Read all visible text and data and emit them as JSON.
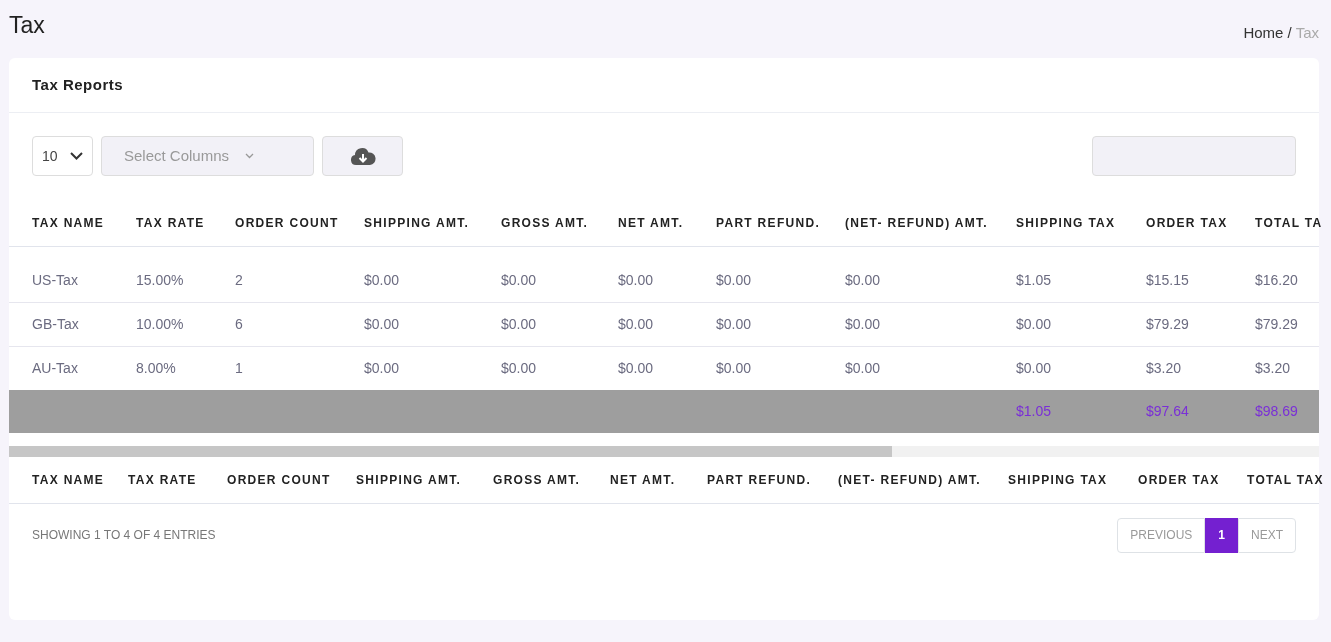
{
  "page_title": "Tax",
  "breadcrumb_separator": "/",
  "breadcrumb": [
    {
      "label": "Home",
      "active": false
    },
    {
      "label": "Tax",
      "active": true
    }
  ],
  "card_title": "Tax Reports",
  "toolbar": {
    "page_size": "10",
    "columns_select": "Select Columns"
  },
  "table": {
    "columns": [
      "TAX NAME",
      "TAX RATE",
      "ORDER COUNT",
      "SHIPPING AMT.",
      "GROSS AMT.",
      "NET AMT.",
      "PART REFUND.",
      "(NET- REFUND) AMT.",
      "SHIPPING TAX",
      "ORDER TAX",
      "TOTAL TA"
    ],
    "rows": [
      [
        "US-Tax",
        "15.00%",
        "2",
        "$0.00",
        "$0.00",
        "$0.00",
        "$0.00",
        "$0.00",
        "$1.05",
        "$15.15",
        "$16.20"
      ],
      [
        "GB-Tax",
        "10.00%",
        "6",
        "$0.00",
        "$0.00",
        "$0.00",
        "$0.00",
        "$0.00",
        "$0.00",
        "$79.29",
        "$79.29"
      ],
      [
        "AU-Tax",
        "8.00%",
        "1",
        "$0.00",
        "$0.00",
        "$0.00",
        "$0.00",
        "$0.00",
        "$0.00",
        "$3.20",
        "$3.20"
      ]
    ],
    "totals": {
      "shipping_tax": "$1.05",
      "order_tax": "$97.64",
      "total_tax": "$98.69"
    },
    "footer_columns": [
      "TAX NAME",
      "TAX RATE",
      "ORDER COUNT",
      "SHIPPING AMT.",
      "GROSS AMT.",
      "NET AMT.",
      "PART REFUND.",
      "(NET- REFUND) AMT.",
      "SHIPPING TAX",
      "ORDER TAX",
      "TOTAL TAX"
    ]
  },
  "info": "SHOWING 1 TO 4 OF 4 ENTRIES",
  "pagination": [
    {
      "label": "PREVIOUS",
      "selected": false
    },
    {
      "label": "1",
      "selected": true
    },
    {
      "label": "NEXT",
      "selected": false
    }
  ]
}
